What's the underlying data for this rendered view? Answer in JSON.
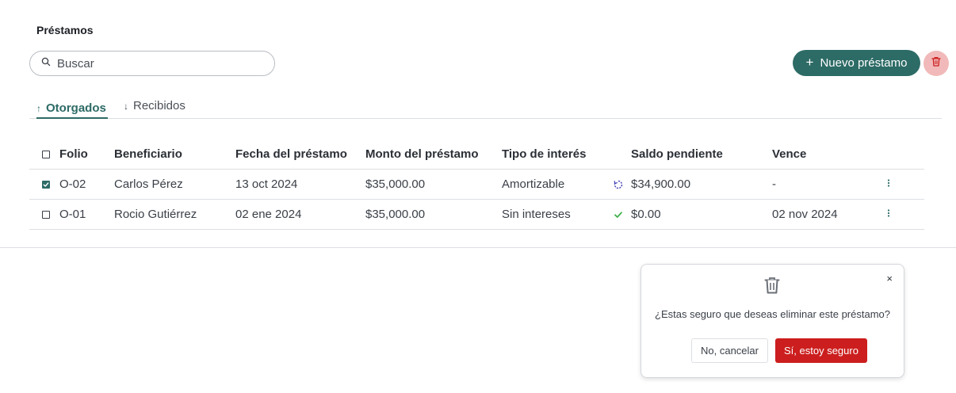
{
  "page": {
    "title": "Préstamos"
  },
  "search": {
    "placeholder": "Buscar",
    "value": ""
  },
  "toolbar": {
    "new_label": "Nuevo préstamo",
    "new_icon": "plus-icon",
    "delete_icon": "trash-icon"
  },
  "tabs": [
    {
      "label": "Otorgados",
      "icon": "arrow-up-icon",
      "active": true
    },
    {
      "label": "Recibidos",
      "icon": "arrow-down-icon",
      "active": false
    }
  ],
  "table": {
    "columns": [
      "Folio",
      "Beneficiario",
      "Fecha del préstamo",
      "Monto del préstamo",
      "Tipo de interés",
      "Saldo pendiente",
      "Vence"
    ],
    "rows": [
      {
        "checked": true,
        "folio": "O-02",
        "beneficiario": "Carlos Pérez",
        "fecha": "13 oct 2024",
        "monto": "$35,000.00",
        "tipo": "Amortizable",
        "status_icon": "in-progress-icon",
        "saldo": "$34,900.00",
        "vence": "-"
      },
      {
        "checked": false,
        "folio": "O-01",
        "beneficiario": "Rocio Gutiérrez",
        "fecha": "02 ene 2024",
        "monto": "$35,000.00",
        "tipo": "Sin intereses",
        "status_icon": "check-icon",
        "saldo": "$0.00",
        "vence": "02 nov 2024"
      }
    ]
  },
  "confirm": {
    "message": "¿Estas seguro que deseas eliminar este préstamo?",
    "cancel_label": "No, cancelar",
    "confirm_label": "Sí, estoy seguro",
    "close_label": "×"
  },
  "colors": {
    "accent": "#2d6b66",
    "danger": "#cc1e1e",
    "danger_soft": "#f1b9b9",
    "progress_icon": "#3b3bb3",
    "success_icon": "#3fb04a"
  }
}
